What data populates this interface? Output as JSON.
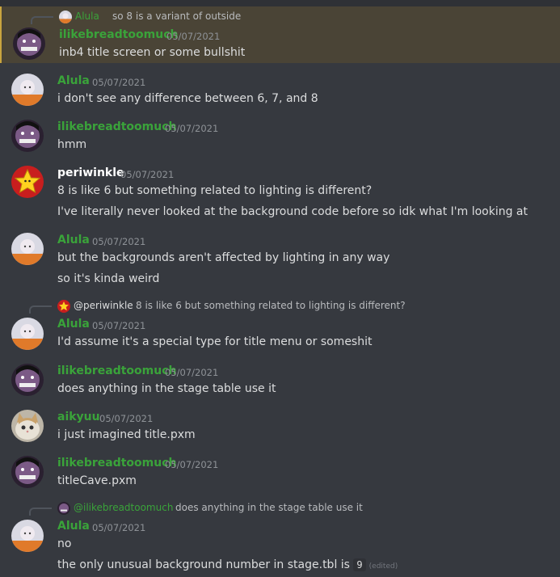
{
  "messages": [
    {
      "author": "ilikebreadtoomuch",
      "time": "05/07/2021",
      "lines": [
        "inb4 title screen or some bullshit"
      ],
      "reply": {
        "author": "Alula",
        "text": "so 8 is a variant of outside"
      }
    },
    {
      "author": "Alula",
      "time": "05/07/2021",
      "lines": [
        "i don't see any difference between 6, 7, and 8"
      ]
    },
    {
      "author": "ilikebreadtoomuch",
      "time": "05/07/2021",
      "lines": [
        "hmm"
      ]
    },
    {
      "author": "periwinkle",
      "time": "05/07/2021",
      "lines": [
        "8 is like 6 but something related to lighting is different?",
        "I've literally never looked at the background code before so idk what I'm looking at"
      ]
    },
    {
      "author": "Alula",
      "time": "05/07/2021",
      "lines": [
        "but the backgrounds aren't affected by lighting in any way",
        "so it's kinda weird"
      ]
    },
    {
      "author": "Alula",
      "time": "05/07/2021",
      "lines": [
        "I'd assume it's a special type for title menu or someshit"
      ],
      "reply": {
        "author": "@periwinkle",
        "text": "8 is like 6 but something related to lighting is different?"
      }
    },
    {
      "author": "ilikebreadtoomuch",
      "time": "05/07/2021",
      "lines": [
        "does anything in the stage table use it"
      ]
    },
    {
      "author": "aikyuu",
      "time": "05/07/2021",
      "lines": [
        "i just imagined title.pxm"
      ]
    },
    {
      "author": "ilikebreadtoomuch",
      "time": "05/07/2021",
      "lines": [
        "titleCave.pxm"
      ]
    },
    {
      "author": "Alula",
      "time": "05/07/2021",
      "lines": [
        "no",
        "the only unusual background number in stage.tbl is"
      ],
      "code": "9",
      "edited": "(edited)",
      "reply": {
        "author": "@ilikebreadtoomuch",
        "text": "does anything in the stage table use it"
      }
    }
  ],
  "colors": {
    "background": "#36393f",
    "mention_highlight": "#4a4436",
    "username_green": "#3aa33a"
  },
  "icons": {
    "alula": "alula-avatar",
    "ilike": "ilikebreadtoomuch-avatar",
    "peri": "star-avatar",
    "aikyuu": "cat-avatar"
  }
}
